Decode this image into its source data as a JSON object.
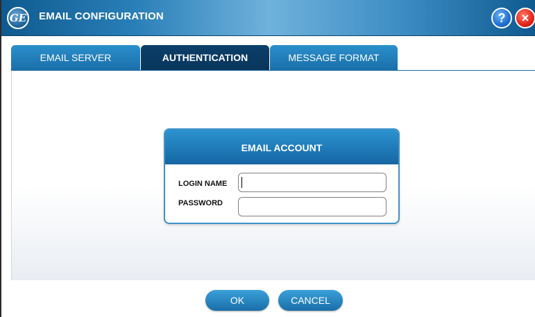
{
  "window": {
    "title": "EMAIL CONFIGURATION",
    "logo_text": "GE",
    "help_label": "?",
    "close_label": "×",
    "colors": {
      "title_bar": "#1f6ea8",
      "accent": "#1a6ea8",
      "active_tab": "#0b3f6a"
    }
  },
  "tabs": [
    {
      "label": "EMAIL SERVER",
      "active": false
    },
    {
      "label": "AUTHENTICATION",
      "active": true
    },
    {
      "label": "MESSAGE FORMAT",
      "active": false
    }
  ],
  "account": {
    "title": "EMAIL ACCOUNT",
    "login_label": "LOGIN NAME",
    "login_value": "",
    "password_label": "PASSWORD",
    "password_value": ""
  },
  "buttons": {
    "ok": "OK",
    "cancel": "CANCEL"
  }
}
